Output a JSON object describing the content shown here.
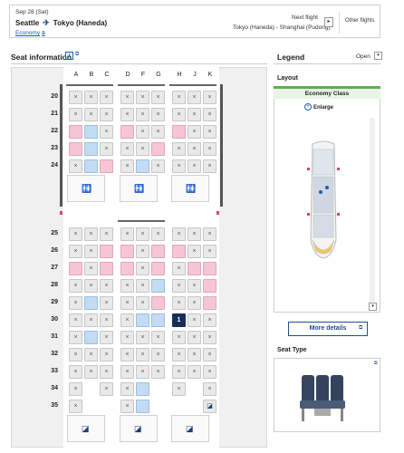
{
  "flight": {
    "date": "Sep 28 (Sat)",
    "origin": "Seattle",
    "destination": "Tokyo (Haneda)",
    "cabin_link": "Economy",
    "next_flight_label": "Next flight",
    "next_route": "Tokyo (Haneda) - Shanghai (Pudong)",
    "next_btn": "▸",
    "other_flights": "Other flights"
  },
  "seat_info": {
    "title": "Seat information",
    "info": "i",
    "ext": "⧉"
  },
  "legend": {
    "title": "Legend",
    "state": "Open",
    "toggle": "▾"
  },
  "seat_map": {
    "columns": [
      "A",
      "B",
      "C",
      "D",
      "F",
      "G",
      "H",
      "J",
      "K"
    ],
    "rows_front": [
      "20",
      "21",
      "22",
      "23",
      "24"
    ],
    "rows_back": [
      "25",
      "26",
      "27",
      "28",
      "29",
      "30",
      "31",
      "32",
      "33",
      "34",
      "35"
    ],
    "selected_seat_label": "1"
  },
  "layout": {
    "title": "Layout",
    "cabin_name": "Economy Class",
    "enlarge": "Enlarge",
    "enlarge_icon": "+",
    "scroll_down": "▾"
  },
  "more_details": {
    "label": "More details",
    "ext": "⧉"
  },
  "seat_type": {
    "title": "Seat Type",
    "ext": "⧉"
  },
  "colors": {
    "accent": "#1b5fb3",
    "selected": "#152f57",
    "pink": "#f6c6d7",
    "blue": "#c3dcf3",
    "green": "#5fae52"
  },
  "icons": {
    "plane": "plane-icon",
    "lavatory": "lavatory-icon",
    "bassinet": "bassinet-icon"
  }
}
